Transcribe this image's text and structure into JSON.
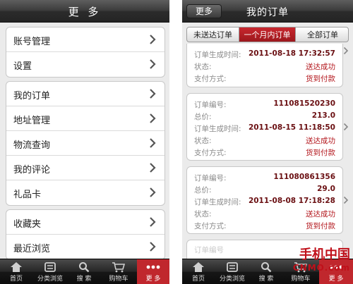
{
  "left": {
    "title": "更 多",
    "groups": [
      {
        "items": [
          "账号管理",
          "设置"
        ]
      },
      {
        "items": [
          "我的订单",
          "地址管理",
          "物流查询",
          "我的评论",
          "礼品卡"
        ]
      },
      {
        "items": [
          "收藏夹",
          "最近浏览"
        ]
      }
    ],
    "tabs": [
      {
        "label": "首页",
        "icon": "home-icon"
      },
      {
        "label": "分类浏览",
        "icon": "category-icon"
      },
      {
        "label": "搜 索",
        "icon": "search-icon"
      },
      {
        "label": "购物车",
        "icon": "cart-icon"
      },
      {
        "label": "更 多",
        "icon": "more-icon",
        "active": true
      }
    ]
  },
  "right": {
    "back_label": "更多",
    "title": "我的订单",
    "segments": [
      {
        "label": "未送达订单"
      },
      {
        "label": "一个月内订单",
        "active": true
      },
      {
        "label": "全部订单"
      }
    ],
    "labels": {
      "order_no": "订单编号:",
      "total": "总价:",
      "created": "订单生成时间:",
      "status": "状态:",
      "payment": "支付方式:"
    },
    "orders": [
      {
        "created": "2011-08-18 17:32:57",
        "status": "送达成功",
        "payment": "货到付款"
      },
      {
        "order_no": "111081520230",
        "total": "213.0",
        "created": "2011-08-15 11:18:50",
        "status": "送达成功",
        "payment": "货到付款"
      },
      {
        "order_no": "111080861356",
        "total": "29.0",
        "created": "2011-08-08 17:18:28",
        "status": "送达成功",
        "payment": "货到付款"
      },
      {
        "order_no": "订单编号"
      }
    ],
    "tabs": [
      {
        "label": "首页",
        "icon": "home-icon"
      },
      {
        "label": "分类浏览",
        "icon": "category-icon"
      },
      {
        "label": "搜 索",
        "icon": "search-icon"
      },
      {
        "label": "购物车",
        "icon": "cart-icon"
      },
      {
        "label": "更 多",
        "icon": "more-icon",
        "active": true
      }
    ]
  },
  "watermark": {
    "line1": "手机中国",
    "line2": "CNMO.com"
  },
  "colors": {
    "accent": "#c0272d",
    "value_red": "#b3161c"
  }
}
